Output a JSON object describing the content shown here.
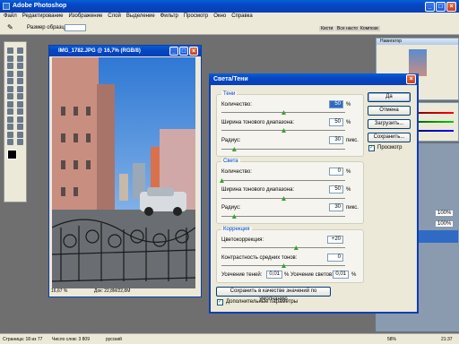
{
  "app": {
    "title": "Adobe Photoshop"
  },
  "menu": [
    "Файл",
    "Редактирование",
    "Изображение",
    "Слой",
    "Выделение",
    "Фильтр",
    "Просмотр",
    "Окно",
    "Справка"
  ],
  "options_bar": {
    "sample_size_label": "Размер образца:"
  },
  "palette_well": {
    "tabs": [
      "Кисти",
      "Все насто",
      "Компози"
    ]
  },
  "document": {
    "title": "IMG_1782.JPG @ 16,7% (RGB/8)",
    "zoom": "16,67 %",
    "doc_info": "Док: 22,8M/22,8M"
  },
  "navigator": {
    "title": "Навигатор"
  },
  "dialog": {
    "title": "Света/Тени",
    "shadows": {
      "title": "Тени",
      "amount_label": "Количество:",
      "amount": "50",
      "amount_pct": 0.5,
      "tonal_label": "Ширина тонового диапазона:",
      "tonal": "50",
      "tonal_pct": 0.5,
      "radius_label": "Радиус:",
      "radius": "30",
      "radius_pct": 0.1
    },
    "highlights": {
      "title": "Света",
      "amount_label": "Количество:",
      "amount": "0",
      "amount_pct": 0.0,
      "tonal_label": "Ширина тонового диапазона:",
      "tonal": "50",
      "tonal_pct": 0.5,
      "radius_label": "Радиус:",
      "radius": "30",
      "radius_pct": 0.1
    },
    "correction": {
      "title": "Коррекция",
      "color_label": "Цветокоррекция:",
      "color": "+20",
      "color_pct": 0.6,
      "midtone_label": "Контрастность средних тонов:",
      "midtone": "0",
      "midtone_pct": 0.5,
      "clip_black_label": "Усечение теней:",
      "clip_black": "0,01",
      "clip_white_label": "% Усечение светов:",
      "clip_white": "0,01"
    },
    "unit_pct": "%",
    "unit_px": "пикс.",
    "save_default": "Сохранить в качестве значений по умолчанию",
    "more_options": "Дополнительные параметры",
    "ok": "Да",
    "cancel": "Отмена",
    "load": "Загрузить...",
    "save": "Сохранить...",
    "preview": "Просмотр"
  },
  "layers_panel": {
    "opacity": "100%",
    "fill": "100%"
  },
  "status": {
    "page": "Страница: 18 из 77",
    "words": "Число слов: 3 809",
    "lang": "русский"
  },
  "taskbar": {
    "zoom": "58%",
    "time": "21:37"
  }
}
